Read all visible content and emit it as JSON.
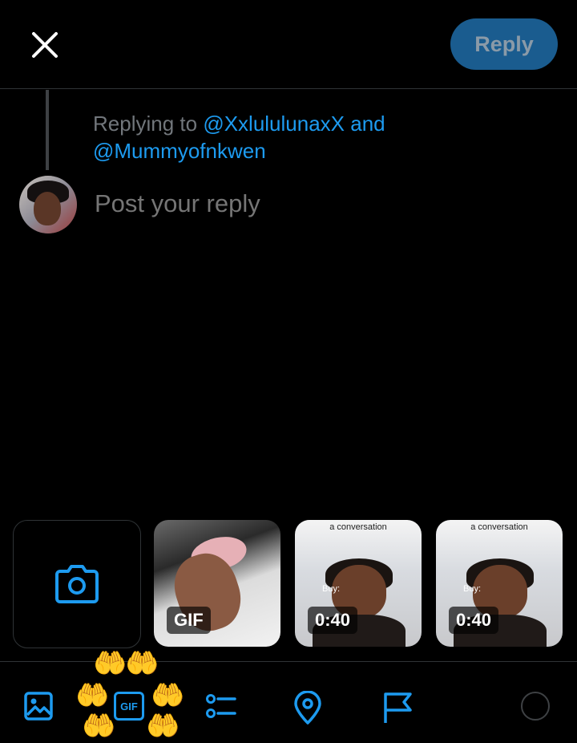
{
  "header": {
    "close_icon": "close-icon",
    "reply_label": "Reply"
  },
  "reply_context": {
    "prefix": "Replying to",
    "handle_1": "@XxlululunaxX",
    "conjunction": "and",
    "handle_2": "@Mummyofnkwen"
  },
  "composer": {
    "placeholder": "Post your reply",
    "value": ""
  },
  "media_strip": {
    "camera_icon": "camera-icon",
    "items": [
      {
        "type": "gif",
        "badge": "GIF"
      },
      {
        "type": "video",
        "badge": "0:40",
        "caption": "a conversation",
        "overlay": "Buy:"
      },
      {
        "type": "video",
        "badge": "0:40",
        "caption": "a conversation",
        "overlay": "Buy:"
      }
    ]
  },
  "toolbar": {
    "icons": [
      "image-icon",
      "gif-icon",
      "poll-icon",
      "location-icon",
      "flag-icon"
    ],
    "gif_label": "GIF",
    "gif_decoration": "hands-emoji-ring"
  },
  "colors": {
    "accent": "#1d9bf0",
    "reply_button_bg": "#1a5c8f",
    "muted_text": "#71767b",
    "background": "#000000",
    "divider": "#2f3336"
  }
}
